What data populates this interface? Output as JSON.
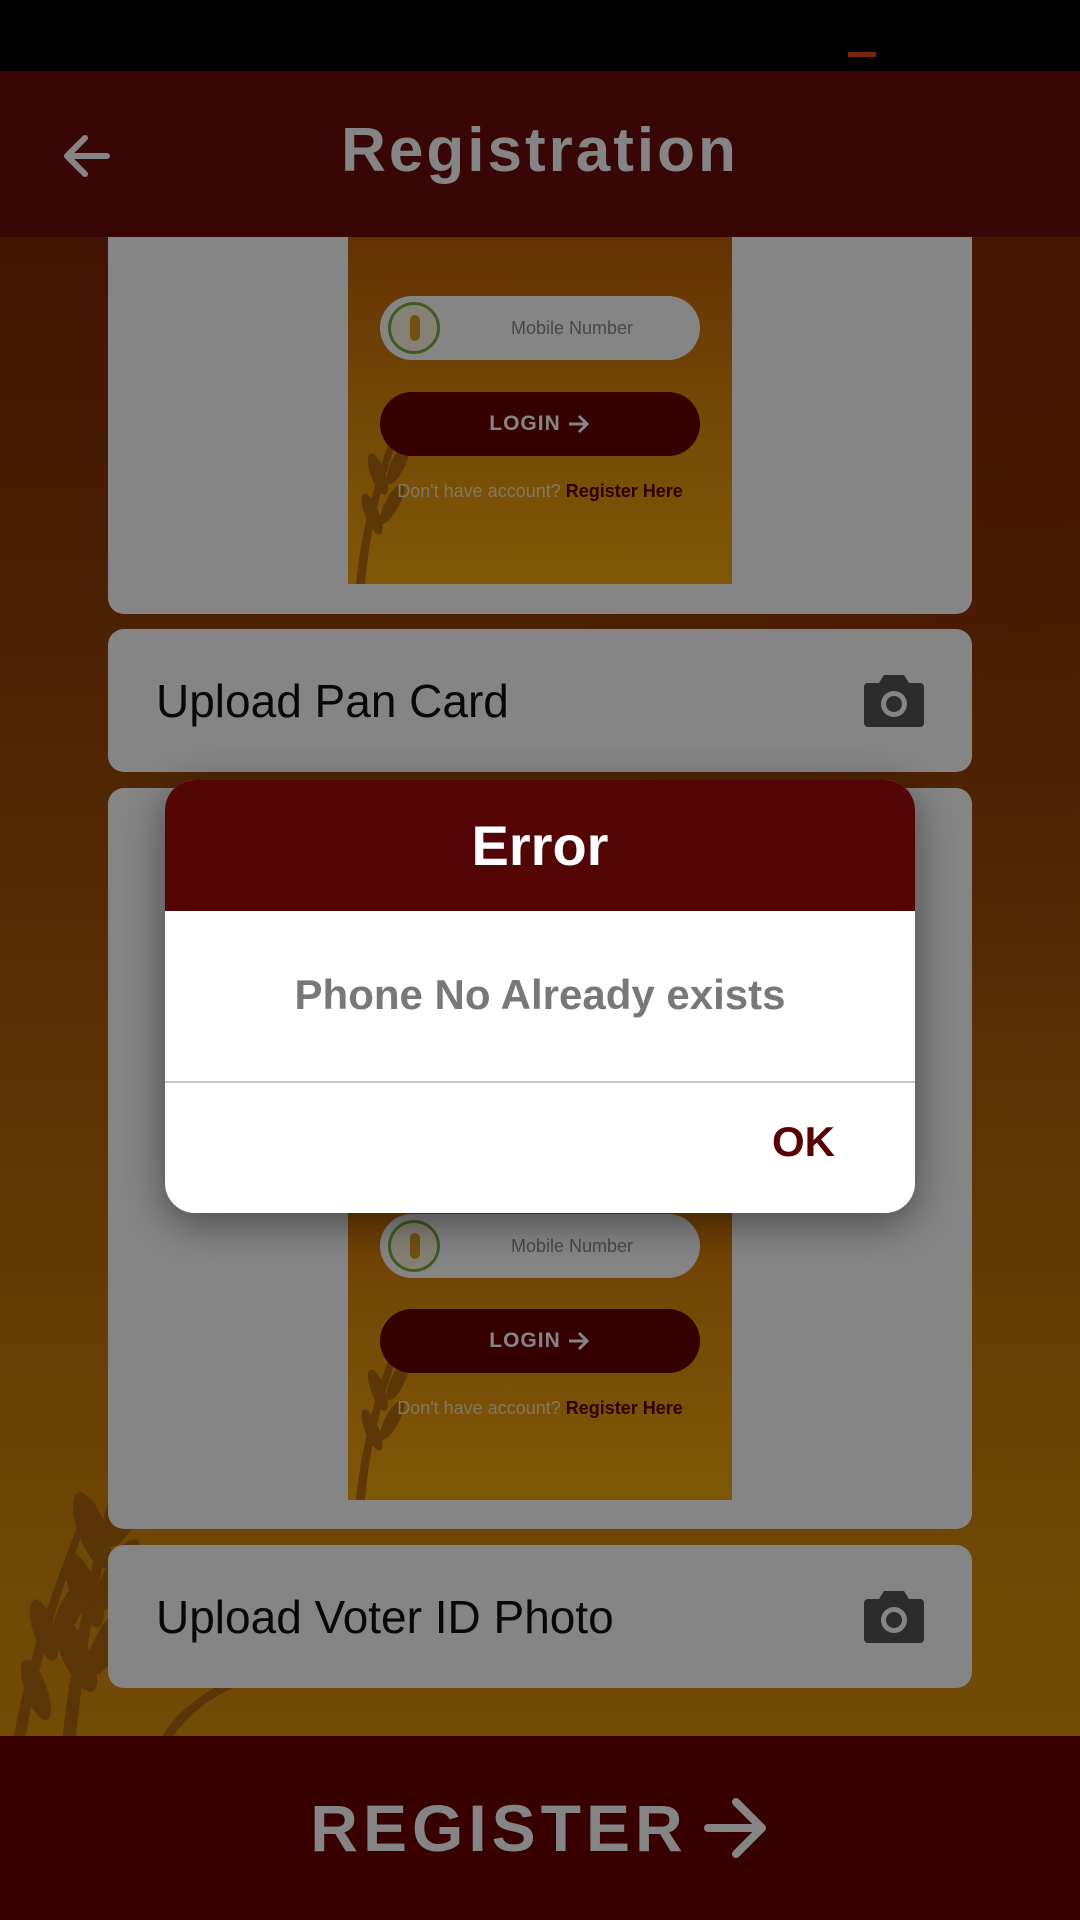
{
  "app_bar": {
    "title": "Registration"
  },
  "sections": {
    "pan_card": {
      "label": "Upload Pan Card"
    },
    "voter_id": {
      "label": "Upload Voter ID Photo"
    }
  },
  "preview": {
    "mobile_placeholder": "Mobile Number",
    "login_label": "LOGIN",
    "no_account_text": "Don't have account?",
    "register_link": "Register Here"
  },
  "footer": {
    "register_label": "REGISTER"
  },
  "dialog": {
    "title": "Error",
    "message": "Phone No Already exists",
    "ok_label": "OK"
  },
  "colors": {
    "app_bar": "#6e0d0d",
    "dialog_header": "#530404",
    "register_bar": "#6e0000",
    "status_indicator": "#e8481c"
  },
  "icons": {
    "back": "arrow-left-icon",
    "camera": "camera-icon",
    "login_arrow": "arrow-right-icon",
    "register_arrow": "arrow-right-icon"
  }
}
